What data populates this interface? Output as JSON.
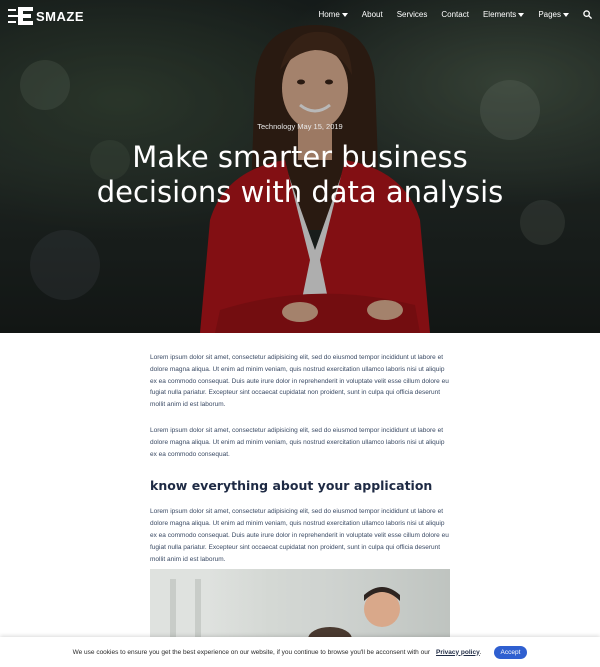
{
  "brand": {
    "name": "SMAZE"
  },
  "nav": {
    "items": [
      {
        "label": "Home",
        "dropdown": true
      },
      {
        "label": "About",
        "dropdown": false
      },
      {
        "label": "Services",
        "dropdown": false
      },
      {
        "label": "Contact",
        "dropdown": false
      },
      {
        "label": "Elements",
        "dropdown": true
      },
      {
        "label": "Pages",
        "dropdown": true
      }
    ],
    "search_icon": "search-icon"
  },
  "hero": {
    "meta": "Technology May 15, 2019",
    "title": "Make smarter business decisions with data analysis"
  },
  "article": {
    "para1": "Lorem ipsum dolor sit amet, consectetur adipisicing elit, sed do eiusmod tempor incididunt ut labore et dolore magna aliqua. Ut enim ad minim veniam, quis nostrud exercitation ullamco laboris nisi ut aliquip ex ea commodo consequat. Duis aute irure dolor in reprehenderit in voluptate velit esse cillum dolore eu fugiat nulla pariatur. Excepteur sint occaecat cupidatat non proident, sunt in culpa qui officia deserunt mollit anim id est laborum.",
    "para2": "Lorem ipsum dolor sit amet, consectetur adipisicing elit, sed do eiusmod tempor incididunt ut labore et dolore magna aliqua. Ut enim ad minim veniam, quis nostrud exercitation ullamco laboris nisi ut aliquip ex ea commodo consequat.",
    "subheading": "know everything about your application",
    "para3": "Lorem ipsum dolor sit amet, consectetur adipisicing elit, sed do eiusmod tempor incididunt ut labore et dolore magna aliqua. Ut enim ad minim veniam, quis nostrud exercitation ullamco laboris nisi ut aliquip ex ea commodo consequat. Duis aute irure dolor in reprehenderit in voluptate velit esse cillum dolore eu fugiat nulla pariatur. Excepteur sint occaecat cupidatat non proident, sunt in culpa qui officia deserunt mollit anim id est laborum."
  },
  "cookie": {
    "text": "We use cookies to ensure you get the best experience on our website, if you continue to browse you'll be acconsent with our",
    "link": "Privacy policy",
    "suffix": ".",
    "accept": "Accept"
  },
  "colors": {
    "accent": "#2f5fd0",
    "heading": "#1e2a44",
    "body_text": "#3a4a64"
  }
}
